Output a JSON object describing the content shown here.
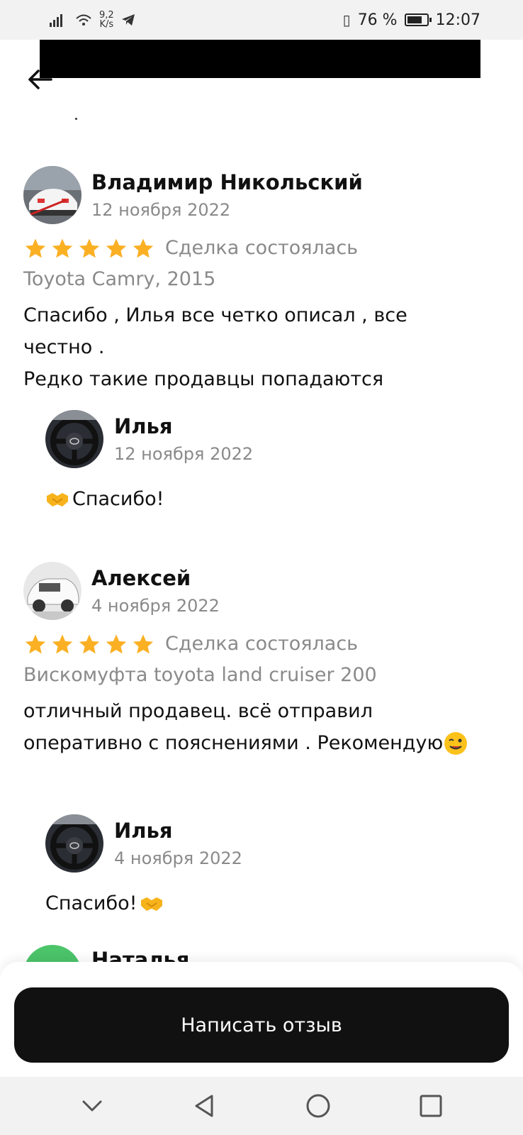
{
  "status_bar": {
    "speed_value": "9,2",
    "speed_unit": "K/s",
    "battery_level": 0.76,
    "battery_text": "76 %",
    "time": "12:07"
  },
  "reviews": [
    {
      "author": "Владимир Никольский",
      "date": "12 ноября 2022",
      "rating": 5,
      "deal_status": "Сделка состоялась",
      "subject": "Toyota Camry, 2015",
      "text_lines": [
        "Спасибо , Илья все четко описал , все",
        "честно .",
        "Редко такие продавцы попадаются"
      ],
      "reply": {
        "author": "Илья",
        "date": "12 ноября 2022",
        "text": "Спасибо!"
      }
    },
    {
      "author": "Алексей",
      "date": "4 ноября 2022",
      "rating": 5,
      "deal_status": "Сделка состоялась",
      "subject": "Вискомуфта toyota land cruiser 200",
      "text_lines": [
        "отличный продавец. всё отправил",
        "оперативно с пояснениями . Рекомендую"
      ],
      "reply": {
        "author": "Илья",
        "date": "4 ноября 2022",
        "text": "Спасибо!"
      }
    },
    {
      "author": "Наталья"
    }
  ],
  "cta": {
    "label": "Написать отзыв"
  },
  "colors": {
    "star": "#FBB024",
    "accent_dark": "#111111",
    "muted_text": "#8A8A8A",
    "avatar_green": "#4CC46A"
  },
  "icons": [
    "back-arrow-icon",
    "star-icon",
    "handshake-icon",
    "wink-emoji-icon",
    "nav-back-icon",
    "nav-home-icon",
    "nav-recents-icon",
    "nav-hide-icon"
  ]
}
